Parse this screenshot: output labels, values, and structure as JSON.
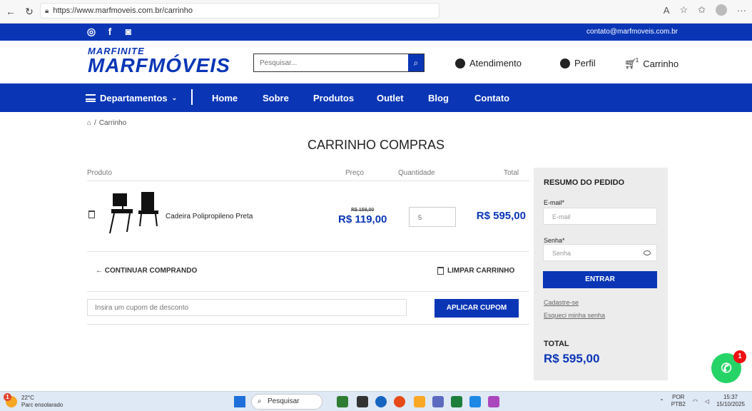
{
  "browser": {
    "url": "https://www.marfmoveis.com.br/carrinho"
  },
  "topbar": {
    "email": "contato@marfmoveis.com.br"
  },
  "header": {
    "logo_top": "MARFINITE",
    "logo_main": "MARFMÓVEIS",
    "search_placeholder": "Pesquisar...",
    "atendimento": "Atendimento",
    "perfil": "Perfil",
    "carrinho": "Carrinho",
    "cart_count": "1"
  },
  "nav": {
    "departamentos": "Departamentos",
    "items": [
      "Home",
      "Sobre",
      "Produtos",
      "Outlet",
      "Blog",
      "Contato"
    ]
  },
  "breadcrumb": {
    "current": "Carrinho"
  },
  "page_title": "CARRINHO COMPRAS",
  "cart": {
    "headers": {
      "produto": "Produto",
      "preco": "Preço",
      "quantidade": "Quantidade",
      "total": "Total"
    },
    "item": {
      "name": "Cadeira Polipropileno Preta",
      "old_price": "R$ 159,00",
      "price": "R$ 119,00",
      "quantity": "5",
      "total": "R$ 595,00"
    },
    "continuar": "← CONTINUAR COMPRANDO",
    "limpar": "LIMPAR CARRINHO",
    "coupon_placeholder": "Insira um cupom de desconto",
    "apply_label": "APLICAR CUPOM"
  },
  "summary": {
    "title": "RESUMO DO PEDIDO",
    "email_label": "E-mail*",
    "email_placeholder": "E-mail",
    "senha_label": "Senha*",
    "senha_placeholder": "Senha",
    "entrar": "ENTRAR",
    "cadastre": "Cadastre-se",
    "esqueci": "Esqueci minha senha",
    "total_label": "TOTAL",
    "total_value": "R$ 595,00"
  },
  "whatsapp": {
    "badge": "1"
  },
  "taskbar": {
    "temp": "22°C",
    "weather": "Parc ensolarado",
    "search": "Pesquisar",
    "lang_top": "POR",
    "lang_bottom": "PTB2",
    "time": "15:37",
    "date": "15/10/2025"
  },
  "colors": {
    "brand_blue": "#0a36b6",
    "whatsapp_green": "#25d366"
  }
}
